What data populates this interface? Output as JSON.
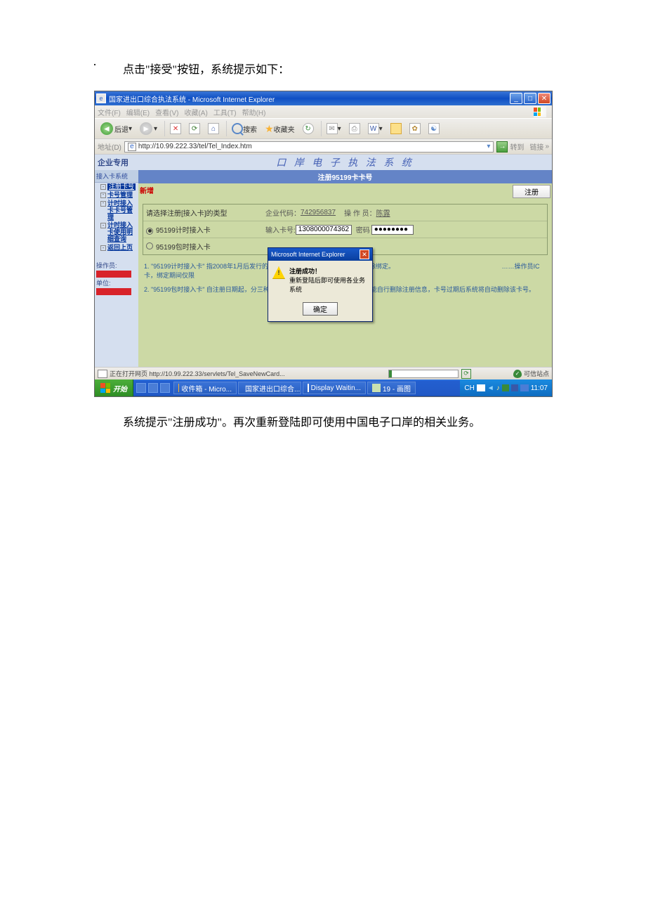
{
  "doc_text_before": "点击\"接受\"按钮，系统提示如下：",
  "doc_text_after": "系统提示\"注册成功\"。再次重新登陆即可使用中国电子口岸的相关业务。",
  "marker": "·",
  "titlebar": {
    "text": "国家进出口综合执法系统 - Microsoft Internet Explorer"
  },
  "menubar": {
    "file": "文件(F)",
    "edit": "编辑(E)",
    "view": "查看(V)",
    "fav": "收藏(A)",
    "tools": "工具(T)",
    "help": "帮助(H)"
  },
  "toolbar": {
    "back": "后退",
    "search": "搜索",
    "fav": "收藏夹"
  },
  "addressbar": {
    "label": "地址(D)",
    "url": "http://10.99.222.33/tel/Tel_Index.htm",
    "go": "转到",
    "links": "链接"
  },
  "app": {
    "enterprise": "企业专用",
    "banner": "口 岸 电 子 执 法 系 统",
    "sidebar": {
      "title": "接入卡系统",
      "items": [
        {
          "label": "注册卡号",
          "active": true
        },
        {
          "label": "卡号管理"
        },
        {
          "label": "计时接入卡卡号管理"
        },
        {
          "label": "计时接入卡使用明细查询"
        },
        {
          "label": "返回上页"
        }
      ],
      "operator_label": "操作员:",
      "unit_label": "单位:"
    },
    "main": {
      "title": "注册95199卡卡号",
      "add": "新增",
      "register": "注册",
      "form": {
        "type_label": "请选择注册[接入卡]的类型",
        "corp_code_label": "企业代码：",
        "corp_code": "742956837",
        "operator_label": "操 作 员：",
        "operator": "陈露",
        "opt1": "95199计时接入卡",
        "opt2": "95199包时接入卡",
        "card_label": "输入卡号:",
        "card_value": "1308000074362",
        "pwd_label": "密码",
        "pwd_value": "●●●●●●●●"
      },
      "note1": "1. \"95199计时接入卡\" 指2008年1月后发行的电……该操作员IC卡使用，可自行解除绑定。",
      "note1_right": "……操作员IC卡，绑定期间仅限",
      "note2": "2. \"95199包时接入卡\" 自注册日期起，分三种：一月、半年或一年内有效，用户不能自行删除注册信息，卡号过期后系统将自动删除该卡号。"
    },
    "alert": {
      "title": "Microsoft Internet Explorer",
      "line1": "注册成功！",
      "line2": "重新登陆后即可使用各业务系统",
      "ok": "确定"
    }
  },
  "statusbar": {
    "loading": "正在打开网页 http://10.99.222.33/servlets/Tel_SaveNewCard...",
    "trusted": "可信站点"
  },
  "taskbar": {
    "start": "开始",
    "items": [
      "收件箱 - Micro...",
      "国家进出口综合...",
      "Display Waitin...",
      "19 - 画图"
    ],
    "lang": "CH",
    "time": "11:07"
  }
}
